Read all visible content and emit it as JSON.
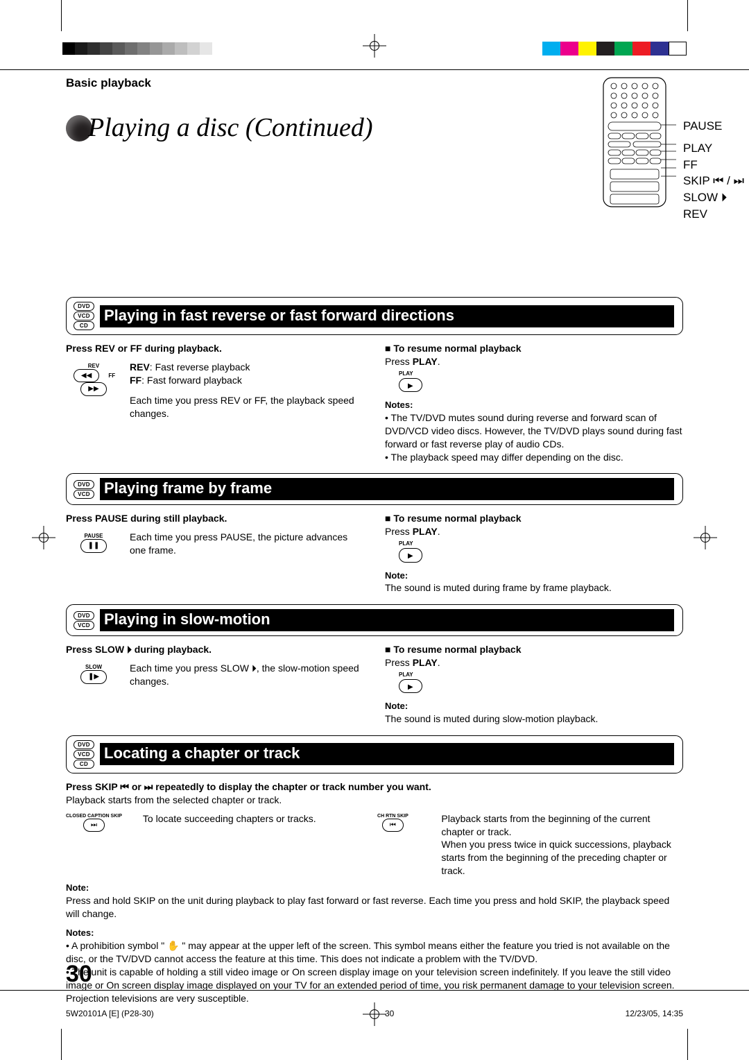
{
  "breadcrumb": "Basic playback",
  "pageTitle": "Playing a disc (Continued)",
  "remoteLabels": [
    "PAUSE",
    "PLAY",
    "FF",
    "SKIP ⏮ / ⏭",
    "SLOW ⏵",
    "REV"
  ],
  "sections": {
    "fastRevFwd": {
      "badges": [
        "DVD",
        "VCD",
        "CD"
      ],
      "title": "Playing in fast reverse or fast forward directions",
      "left": {
        "heading": "Press REV or FF during playback.",
        "btnLabels": {
          "rev": "REV",
          "ff": "FF"
        },
        "lines": [
          {
            "key": "REV",
            "val": ": Fast reverse playback"
          },
          {
            "key": "FF",
            "val": ": Fast forward playback"
          }
        ],
        "after": "Each time you press REV or FF, the playback speed changes."
      },
      "right": {
        "resumeTitle": "To resume normal playback",
        "resumeBody": "Press PLAY.",
        "playBtn": "PLAY",
        "notesTitle": "Notes:",
        "notes": [
          "The TV/DVD mutes sound during reverse and forward scan of DVD/VCD video discs. However, the TV/DVD plays sound during fast forward or fast reverse play of audio CDs.",
          "The playback speed may differ depending on the disc."
        ]
      }
    },
    "frameByFrame": {
      "badges": [
        "DVD",
        "VCD"
      ],
      "title": "Playing frame by frame",
      "left": {
        "heading": "Press PAUSE during still playback.",
        "btnLabel": "PAUSE",
        "body": "Each time you press PAUSE, the picture advances one frame."
      },
      "right": {
        "resumeTitle": "To resume normal playback",
        "resumeBody": "Press PLAY.",
        "playBtn": "PLAY",
        "noteTitle": "Note:",
        "note": "The sound is muted during frame by frame playback."
      }
    },
    "slowMotion": {
      "badges": [
        "DVD",
        "VCD"
      ],
      "title": "Playing in slow-motion",
      "left": {
        "heading": "Press SLOW ⏵ during playback.",
        "btnLabel": "SLOW",
        "body": "Each time you press SLOW ⏵, the slow-motion speed changes."
      },
      "right": {
        "resumeTitle": "To resume normal playback",
        "resumeBody": "Press PLAY.",
        "playBtn": "PLAY",
        "noteTitle": "Note:",
        "note": "The sound is muted during slow-motion playback."
      }
    },
    "locate": {
      "badges": [
        "DVD",
        "VCD",
        "CD"
      ],
      "title": "Locating a chapter or track",
      "instruction": "Press SKIP ⏮ or ⏭ repeatedly to display the chapter or track number you want.",
      "sub": "Playback starts from the selected chapter or track.",
      "fwdLabel": "CLOSED CAPTION\nSKIP",
      "fwdGlyph": "⏭",
      "fwdText": "To locate succeeding chapters or tracks.",
      "revLabel": "CH RTN\nSKIP",
      "revGlyph": "⏮",
      "revText": "Playback starts from the beginning of the current chapter or track.\nWhen you press twice in quick successions, playback starts from the beginning of the preceding chapter or track.",
      "noteTitle": "Note:",
      "noteBody": "Press and hold SKIP on the unit during playback to play fast forward or fast reverse. Each time you press and hold SKIP, the playback speed will change."
    }
  },
  "bottomNotes": {
    "title": "Notes:",
    "items": [
      "A prohibition symbol \" ✋ \" may appear at the upper left of the screen. This symbol means either the feature you tried is not available on the disc, or the TV/DVD cannot access the feature at this time. This does not indicate a problem with the TV/DVD.",
      "The unit is capable of holding a still video image or On screen display image on your television screen indefinitely. If you leave the still video image or On screen display image displayed on your TV for an extended period of time, you risk permanent damage to your television screen. Projection televisions are very susceptible."
    ]
  },
  "pageNumber": "30",
  "footer": {
    "left": "5W20101A [E] (P28-30)",
    "center": "30",
    "right": "12/23/05, 14:35"
  }
}
